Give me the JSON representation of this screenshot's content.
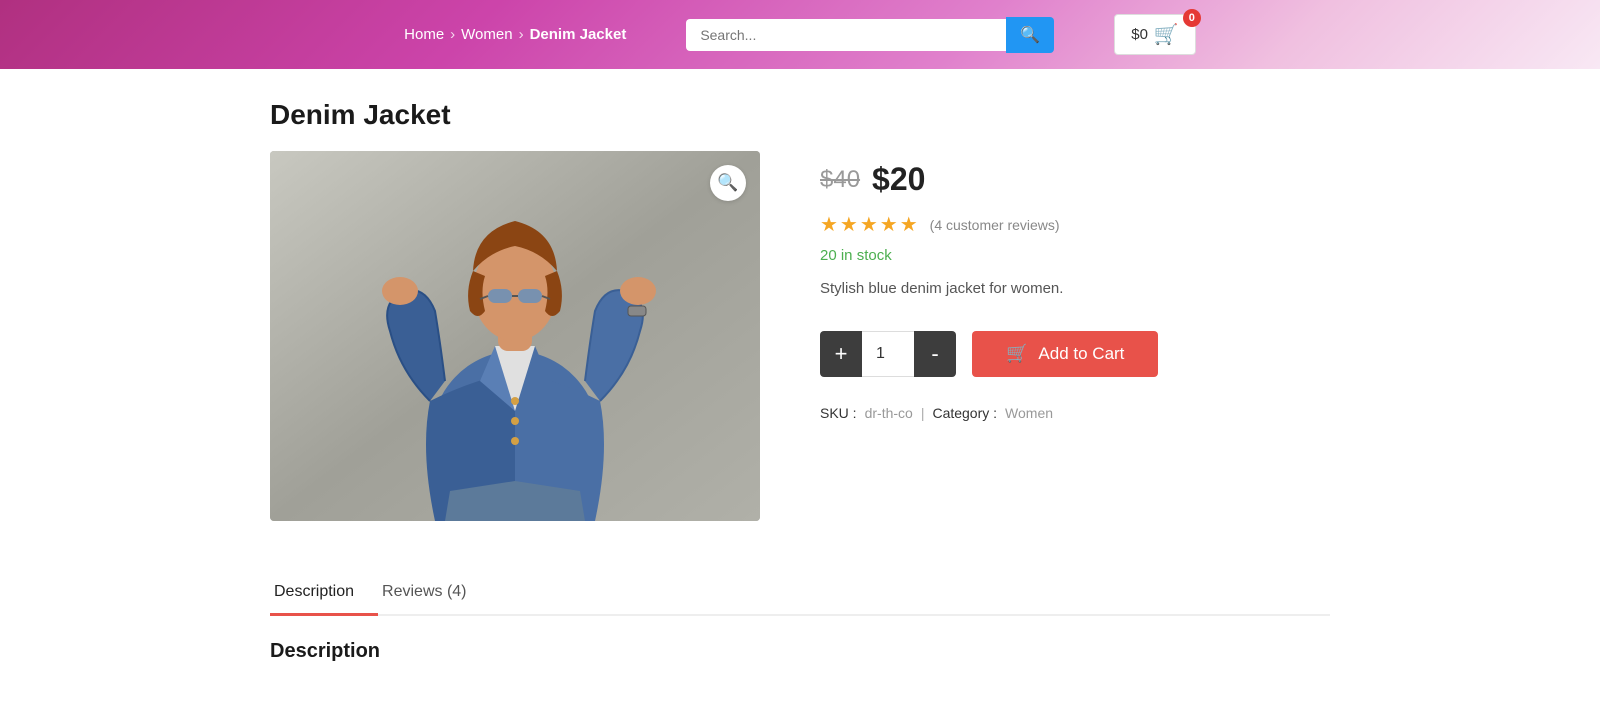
{
  "header": {
    "breadcrumb": {
      "home": "Home",
      "women": "Women",
      "current": "Denim Jacket",
      "separator": "›"
    },
    "search": {
      "placeholder": "Search...",
      "button_icon": "🔍"
    },
    "cart": {
      "amount": "$0",
      "item_count": "0",
      "icon": "🛒"
    }
  },
  "product": {
    "title": "Denim Jacket",
    "price_original": "$40",
    "price_current": "$20",
    "rating_stars": "★★★★★",
    "reviews_count": "(4 customer reviews)",
    "stock_text": "20 in stock",
    "description": "Stylish blue denim jacket for women.",
    "sku_label": "SKU :",
    "sku_value": "dr-th-co",
    "category_label": "Category :",
    "category_value": "Women",
    "meta_separator": "|",
    "qty_value": "1",
    "qty_decrease": "-",
    "qty_increase": "+",
    "add_to_cart_label": "Add to Cart",
    "zoom_icon": "🔍"
  },
  "tabs": {
    "description": {
      "label": "Description",
      "active": true,
      "content_title": "Description"
    },
    "reviews": {
      "label": "Reviews (4)",
      "active": false
    }
  }
}
